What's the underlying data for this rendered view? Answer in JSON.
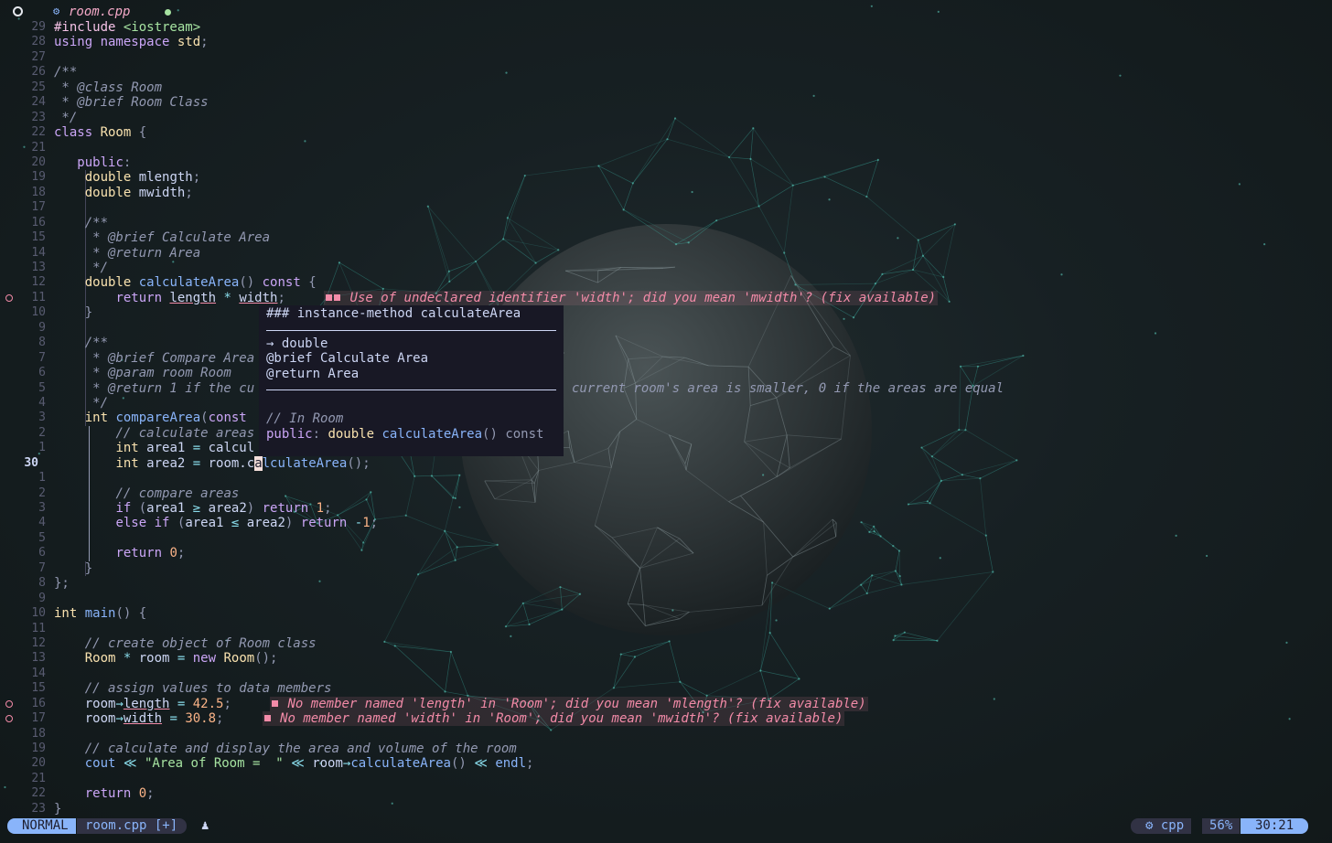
{
  "tab": {
    "icon": "cpp-file-icon",
    "filename": "room.cpp"
  },
  "lines": [
    {
      "n": "29",
      "segs": [
        [
          "pp",
          "#include "
        ],
        [
          "st",
          "<iostream>"
        ]
      ]
    },
    {
      "n": "28",
      "segs": [
        [
          "kw",
          "using namespace "
        ],
        [
          "ty",
          "std"
        ],
        [
          "pu",
          ";"
        ]
      ]
    },
    {
      "n": "27",
      "segs": []
    },
    {
      "n": "26",
      "segs": [
        [
          "cm",
          "/**"
        ]
      ]
    },
    {
      "n": "25",
      "segs": [
        [
          "cm",
          " * @class Room"
        ]
      ]
    },
    {
      "n": "24",
      "segs": [
        [
          "cm",
          " * @brief Room Class"
        ]
      ]
    },
    {
      "n": "23",
      "segs": [
        [
          "cm",
          " */"
        ]
      ]
    },
    {
      "n": "22",
      "segs": [
        [
          "kw",
          "class "
        ],
        [
          "ty",
          "Room"
        ],
        [
          "pu",
          " {"
        ]
      ]
    },
    {
      "n": "21",
      "segs": []
    },
    {
      "n": "20",
      "segs": [
        [
          "",
          "   "
        ],
        [
          "kw",
          "public"
        ],
        [
          "pu",
          ":"
        ]
      ]
    },
    {
      "n": "19",
      "segs": [
        [
          "",
          "    "
        ],
        [
          "ty",
          "double "
        ],
        [
          "",
          "mlength"
        ],
        [
          "pu",
          ";"
        ]
      ]
    },
    {
      "n": "18",
      "segs": [
        [
          "",
          "    "
        ],
        [
          "ty",
          "double "
        ],
        [
          "",
          "mwidth"
        ],
        [
          "pu",
          ";"
        ]
      ]
    },
    {
      "n": "17",
      "segs": []
    },
    {
      "n": "16",
      "segs": [
        [
          "",
          "    "
        ],
        [
          "cm",
          "/**"
        ]
      ]
    },
    {
      "n": "15",
      "segs": [
        [
          "",
          "    "
        ],
        [
          "cm",
          " * @brief Calculate Area"
        ]
      ]
    },
    {
      "n": "14",
      "segs": [
        [
          "",
          "    "
        ],
        [
          "cm",
          " * @return Area"
        ]
      ]
    },
    {
      "n": "13",
      "segs": [
        [
          "",
          "    "
        ],
        [
          "cm",
          " */"
        ]
      ]
    },
    {
      "n": "12",
      "segs": [
        [
          "",
          "    "
        ],
        [
          "ty",
          "double "
        ],
        [
          "fn",
          "calculateArea"
        ],
        [
          "pu",
          "() "
        ],
        [
          "kw",
          "const"
        ],
        [
          "pu",
          " {"
        ]
      ]
    },
    {
      "n": "11",
      "sign": true,
      "segs": [
        [
          "",
          "        "
        ],
        [
          "kw",
          "return "
        ],
        [
          "und",
          "length"
        ],
        [
          "op",
          " * "
        ],
        [
          "und",
          "width"
        ],
        [
          "pu",
          ";"
        ]
      ],
      "diag": "Use of undeclared identifier 'width'; did you mean 'mwidth'? (fix available)",
      "diag_sq": 2
    },
    {
      "n": "10",
      "segs": [
        [
          "",
          "    "
        ],
        [
          "pu",
          "}"
        ]
      ]
    },
    {
      "n": "9",
      "segs": []
    },
    {
      "n": "8",
      "segs": [
        [
          "",
          "    "
        ],
        [
          "cm",
          "/**"
        ]
      ]
    },
    {
      "n": "7",
      "segs": [
        [
          "",
          "    "
        ],
        [
          "cm",
          " * @brief Compare Area"
        ]
      ]
    },
    {
      "n": "6",
      "segs": [
        [
          "",
          "    "
        ],
        [
          "cm",
          " * @param room Room"
        ]
      ]
    },
    {
      "n": "5",
      "segs": [
        [
          "",
          "    "
        ],
        [
          "cm",
          " * @return 1 if the cu"
        ]
      ],
      "tail": "current room's area is smaller, 0 if the areas are equal"
    },
    {
      "n": "4",
      "segs": [
        [
          "",
          "    "
        ],
        [
          "cm",
          " */"
        ]
      ]
    },
    {
      "n": "3",
      "segs": [
        [
          "",
          "    "
        ],
        [
          "ty",
          "int "
        ],
        [
          "fn",
          "compareArea"
        ],
        [
          "pu",
          "("
        ],
        [
          "kw",
          "const"
        ]
      ]
    },
    {
      "n": "2",
      "segs": [
        [
          "",
          "        "
        ],
        [
          "cm",
          "// calculate areas"
        ]
      ]
    },
    {
      "n": "1",
      "segs": [
        [
          "",
          "        "
        ],
        [
          "ty",
          "int "
        ],
        [
          "",
          "area1 "
        ],
        [
          "op",
          "= "
        ],
        [
          "",
          "calcul"
        ]
      ]
    },
    {
      "n": "30",
      "cur": true,
      "segs": [
        [
          "",
          "        "
        ],
        [
          "ty",
          "int "
        ],
        [
          "",
          "area2 "
        ],
        [
          "op",
          "= "
        ],
        [
          "",
          "room."
        ],
        [
          "",
          "c"
        ],
        [
          "cursor",
          "a"
        ],
        [
          "fn",
          "lculateArea"
        ],
        [
          "pu",
          "();"
        ]
      ]
    },
    {
      "n": "1",
      "segs": []
    },
    {
      "n": "2",
      "segs": [
        [
          "",
          "        "
        ],
        [
          "cm",
          "// compare areas"
        ]
      ]
    },
    {
      "n": "3",
      "segs": [
        [
          "",
          "        "
        ],
        [
          "kw",
          "if "
        ],
        [
          "pu",
          "("
        ],
        [
          "",
          "area1 "
        ],
        [
          "op",
          "≥ "
        ],
        [
          "",
          "area2"
        ],
        [
          "pu",
          ") "
        ],
        [
          "kw",
          "return "
        ],
        [
          "nu",
          "1"
        ],
        [
          "pu",
          ";"
        ]
      ]
    },
    {
      "n": "4",
      "segs": [
        [
          "",
          "        "
        ],
        [
          "kw",
          "else if "
        ],
        [
          "pu",
          "("
        ],
        [
          "",
          "area1 "
        ],
        [
          "op",
          "≤ "
        ],
        [
          "",
          "area2"
        ],
        [
          "pu",
          ") "
        ],
        [
          "kw",
          "return "
        ],
        [
          "op",
          "-"
        ],
        [
          "nu",
          "1"
        ],
        [
          "pu",
          ";"
        ]
      ]
    },
    {
      "n": "5",
      "segs": []
    },
    {
      "n": "6",
      "segs": [
        [
          "",
          "        "
        ],
        [
          "kw",
          "return "
        ],
        [
          "nu",
          "0"
        ],
        [
          "pu",
          ";"
        ]
      ]
    },
    {
      "n": "7",
      "segs": [
        [
          "",
          "    "
        ],
        [
          "pu",
          "}"
        ]
      ]
    },
    {
      "n": "8",
      "segs": [
        [
          "pu",
          "};"
        ]
      ]
    },
    {
      "n": "9",
      "segs": []
    },
    {
      "n": "10",
      "segs": [
        [
          "ty",
          "int "
        ],
        [
          "fn",
          "main"
        ],
        [
          "pu",
          "() {"
        ]
      ]
    },
    {
      "n": "11",
      "segs": []
    },
    {
      "n": "12",
      "segs": [
        [
          "",
          "    "
        ],
        [
          "cm",
          "// create object of Room class"
        ]
      ]
    },
    {
      "n": "13",
      "segs": [
        [
          "",
          "    "
        ],
        [
          "ty",
          "Room "
        ],
        [
          "op",
          "* "
        ],
        [
          "",
          "room "
        ],
        [
          "op",
          "= "
        ],
        [
          "kw",
          "new "
        ],
        [
          "ty",
          "Room"
        ],
        [
          "pu",
          "();"
        ]
      ]
    },
    {
      "n": "14",
      "segs": []
    },
    {
      "n": "15",
      "segs": [
        [
          "",
          "    "
        ],
        [
          "cm",
          "// assign values to data members"
        ]
      ]
    },
    {
      "n": "16",
      "sign": true,
      "segs": [
        [
          "",
          "    "
        ],
        [
          "",
          "room"
        ],
        [
          "op",
          "→"
        ],
        [
          "und",
          "length"
        ],
        [
          "op",
          " = "
        ],
        [
          "nu",
          "42.5"
        ],
        [
          "pu",
          ";"
        ]
      ],
      "diag": "No member named 'length' in 'Room'; did you mean 'mlength'? (fix available)",
      "diag_sq": 1
    },
    {
      "n": "17",
      "sign": true,
      "segs": [
        [
          "",
          "    "
        ],
        [
          "",
          "room"
        ],
        [
          "op",
          "→"
        ],
        [
          "und",
          "width"
        ],
        [
          "op",
          " = "
        ],
        [
          "nu",
          "30.8"
        ],
        [
          "pu",
          ";"
        ]
      ],
      "diag": "No member named 'width' in 'Room'; did you mean 'mwidth'? (fix available)",
      "diag_sq": 1
    },
    {
      "n": "18",
      "segs": []
    },
    {
      "n": "19",
      "segs": [
        [
          "",
          "    "
        ],
        [
          "cm",
          "// calculate and display the area and volume of the room"
        ]
      ]
    },
    {
      "n": "20",
      "segs": [
        [
          "",
          "    "
        ],
        [
          "fn",
          "cout "
        ],
        [
          "op",
          "≪ "
        ],
        [
          "st",
          "\"Area of Room =  \""
        ],
        [
          "op",
          " ≪ "
        ],
        [
          "",
          "room"
        ],
        [
          "op",
          "→"
        ],
        [
          "fn",
          "calculateArea"
        ],
        [
          "pu",
          "() "
        ],
        [
          "op",
          "≪ "
        ],
        [
          "fn",
          "endl"
        ],
        [
          "pu",
          ";"
        ]
      ]
    },
    {
      "n": "21",
      "segs": []
    },
    {
      "n": "22",
      "segs": [
        [
          "",
          "    "
        ],
        [
          "kw",
          "return "
        ],
        [
          "nu",
          "0"
        ],
        [
          "pu",
          ";"
        ]
      ]
    },
    {
      "n": "23",
      "segs": [
        [
          "pu",
          "}"
        ]
      ]
    }
  ],
  "hover": {
    "heading": "### instance-method calculateArea",
    "returns": "→ double",
    "brief": "@brief Calculate Area",
    "ret": "@return Area",
    "scope_comment": "// In Room",
    "sig_kw": "public",
    "sig_type": "double",
    "sig_fn": "calculateArea",
    "sig_rest": "() const"
  },
  "status": {
    "mode": "NORMAL",
    "file": "room.cpp [+]",
    "user_icon": "person-icon",
    "filetype_icon": "cpp-icon",
    "filetype": "cpp",
    "percent": "56%",
    "position": "30:21"
  }
}
